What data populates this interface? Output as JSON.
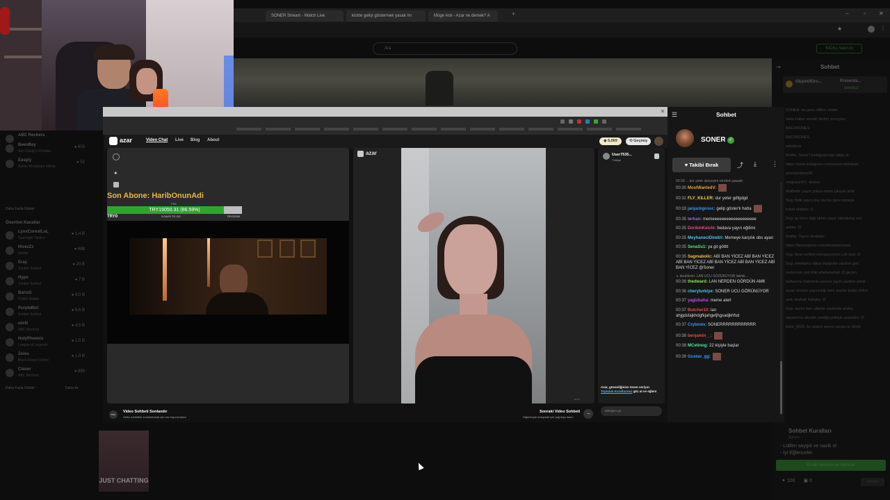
{
  "browser": {
    "tabs": [
      {
        "label": "SONER Stream - Watch Live"
      },
      {
        "label": "kickte gelişi göstermek yasak mı"
      },
      {
        "label": "Müge Anlı - Azar ne demek? A"
      }
    ],
    "kick_search_placeholder": "Ara",
    "kick_buy_label": "KICKs Satın Al"
  },
  "sidebar": {
    "rows": [
      {
        "name": "ABC Rechers",
        "sub": "",
        "count": ""
      },
      {
        "name": "BeenBey",
        "sub": "Sen Ödeşli's Ronaldo",
        "count": "● 603"
      },
      {
        "name": "Easply",
        "sub": "Anime Broadcast Infinite",
        "count": "● 52"
      }
    ],
    "more_label": "Daha Fazla Göster",
    "recommended_title": "Önerilen Kanallar",
    "recommended": [
      {
        "name": "LynxCorestLoL",
        "sub": "Teamfight Tactics",
        "count": "● 1,4 B"
      },
      {
        "name": "HivezZz",
        "sub": "Global",
        "count": "● 688"
      },
      {
        "name": "Eray",
        "sub": "Sohbet Sohbet",
        "count": "● 20 B"
      },
      {
        "name": "Hype",
        "sub": "Sohbet Sohbet",
        "count": "● 7 B"
      },
      {
        "name": "BarisG",
        "sub": "PUBG Mobile",
        "count": "● 6,0 B"
      },
      {
        "name": "PurpleBixi",
        "sub": "Sohbet Sohbet",
        "count": "● 6,6 B"
      },
      {
        "name": "wicN",
        "sub": "ABC Rechers",
        "count": "● 4,5 B"
      },
      {
        "name": "HolyPhoenix",
        "sub": "League of Legends",
        "count": "● 1,5 B"
      },
      {
        "name": "Zeisu",
        "sub": "Black Desert Online",
        "count": "● 1,9 B"
      },
      {
        "name": "Claner",
        "sub": "ABC Rechers",
        "count": "● 880"
      }
    ],
    "bottom_more": "Daha Fazla Göster",
    "bottom_less": "Daha Az"
  },
  "kick_chat": {
    "title": "Sohbet",
    "pinned": "ObjektifOrn...",
    "pinned_2": "Presenta...",
    "pinned_3": "SenaSu1",
    "lines": [
      "SONER: bu gece offline chatte",
      "daha haber verebil dedim sonuçları",
      "BACKBONES",
      "BACKBONES",
      "adeslens",
      "BotNo: Soner'i instagram'dan takip et",
      "https://www.instagram.com/sonerrahimbas/",
      "gourisimdoss95",
      "rangraver52: derken",
      "AbiBedir: yayın yoksu adam şikayet artık",
      "Sog: fistik yayın olur mu bu gece izmeye",
      "kutuk ufaktan :D",
      "Sog: az önce lalgi aldım yayın olacakmış sen",
      "askler :D",
      "BotNo: Yayını destekle:",
      "https://fanyosjeme.com/destekle/soner",
      "Sog: biraz sohbet konuşuyorsun çok ayıp :D",
      "Sog: erkekartız dijital duyguları yazdım geri",
      "veriyorum çok kötü ahahahahah :D geçen",
      "haftasonu trabzonlu yanına yayın yazdım şimdi",
      "azzar ümrüm yayıncılığı beni sevme kadar lütfen",
      "amk ahahah hahaha :D",
      "Sog: neyse ben cilalılar usulünde araba",
      "dayanımın aksolin verdiği yetkiyle uzanalım :D",
      "bekir_5825: bu adamı seçmi yarıya ne böyle"
    ],
    "rules_title": "Sohbet Kuralları",
    "rules_sub": "Soners",
    "rules": [
      "- Lütfen saygılı ve nazik ol",
      "- İyi Eğlenceler"
    ],
    "rules_button": "Kuralı okudum ve kabul et",
    "points": "100",
    "gifts": "0",
    "send": "Sohbet"
  },
  "banner_close": "✕",
  "window": {
    "close": "✕"
  },
  "azar": {
    "logo": "azar",
    "nav": [
      "Video Chat",
      "Live",
      "Blog",
      "About"
    ],
    "gems": "5,069",
    "history": "Geçmiş",
    "sub_title": "Son Abone: HaribOnunAdi",
    "goal_small": "PS5",
    "goal_text": "TRY19050.31 (86.59%)",
    "goal_fraction": 0.8659,
    "goal_currency": "TRY0",
    "goal_days": "3 DAYS TO GO",
    "goal_target": "TRY22000",
    "mid_logo": "azar",
    "user_name": "User7535...",
    "user_loc": "Türkiye",
    "safety_text": "Azar, güvenliğinize önem veriyor.",
    "safety_link": "Topluluk Kurallarımız",
    "safety_text2": "göz at ve eğlen!",
    "input_placeholder": "Mesajını gir",
    "end_title": "Video Sohbeti Sonlandır",
    "end_sub": "Video sohbetini sonlandırmak için esc tuşuna basın",
    "end_icon": "esc",
    "next_title": "Sonraki Video Sohbeti",
    "next_sub": "Diğerleriyle buluşmak için sağ tuşa basın",
    "next_icon": "→"
  },
  "inner_chat": {
    "title": "Sohbet",
    "streamer": "SONER",
    "unfollow": "Takibi Bırak",
    "messages": [
      {
        "type": "cut",
        "text": "00:29 ... dur yeter işteyeyim rendem jaaaah"
      },
      {
        "time": "00:30",
        "user": "MostWantedV",
        "color": "#e6a14a",
        "text": "",
        "emote": true
      },
      {
        "time": "00:32",
        "user": "FLY_KILLER",
        "color": "#f0d040",
        "text": "dur yeter gdfgdgd"
      },
      {
        "time": "00:33",
        "user": "janjackgossc",
        "color": "#3a9ae8",
        "text": "gelip göster'k hatta",
        "emote": true
      },
      {
        "time": "00:35",
        "user": "terhan",
        "color": "#9a6ae8",
        "text": "memeeeeeeeeeeeeeeeeeee"
      },
      {
        "time": "00:35",
        "user": "DorikinKeichi",
        "color": "#e84a8a",
        "text": "bedava yayın eğitimi"
      },
      {
        "time": "00:35",
        "user": "MeyhaneciDimitri",
        "color": "#4ac8e8",
        "text": "Memeye karşılık obs ayarı"
      },
      {
        "time": "00:35",
        "user": "SenaSu1",
        "color": "#4ae878",
        "text": "ya git götttt"
      },
      {
        "time": "00:35",
        "user": "Sagmabolic",
        "color": "#e8c84a",
        "text": "ABİ BAN YİCEZ ABİ BAN YİCEZ ABİ BAN YİCEZ ABİ BAN YİCEZ ABİ BAN YİCEZ ABİ BAN YİCEZ @Soner"
      },
      {
        "type": "reply",
        "text": "↳ doublexin: LAN UCU GÖZÜKÜYOR lakmk..."
      },
      {
        "time": "00:36",
        "user": "thedward",
        "color": "#8ae84a",
        "text": "LAN NERDEN GÖRDÜN AMK"
      },
      {
        "time": "00:36",
        "user": "cheryturkiye",
        "color": "#4ac8e8",
        "text": "SONER UCU GÖRÜNÜYOR"
      },
      {
        "time": "00:37",
        "user": "yagizbaha",
        "color": "#c84ae8",
        "text": "meme alert"
      },
      {
        "time": "00:37",
        "user": "Butcher10",
        "color": "#e84a4a",
        "text": "lan ahjgdsfajkhdgfkjahgefjhgsadjkhfsd"
      },
      {
        "time": "00:37",
        "user": "Crybows",
        "color": "#3a9ae8",
        "text": "SONERRRRRRRRRRRR"
      },
      {
        "time": "00:38",
        "user": "benjamin__",
        "color": "#e84a4a",
        "text": "",
        "emote": true
      },
      {
        "time": "00:38",
        "user": "MCetinog",
        "color": "#4ae8a8",
        "text": "22 kişiyle başlar"
      },
      {
        "time": "00:39",
        "user": "Gustav_gg",
        "color": "#3a9ae8",
        "text": "",
        "emote": true
      }
    ]
  },
  "below": {
    "category": "JUST CHATTING"
  },
  "colors": {
    "goal_green": "#2fa52f",
    "sub_title_gold": "#e6b84a",
    "verified_green": "#3aa53a"
  }
}
